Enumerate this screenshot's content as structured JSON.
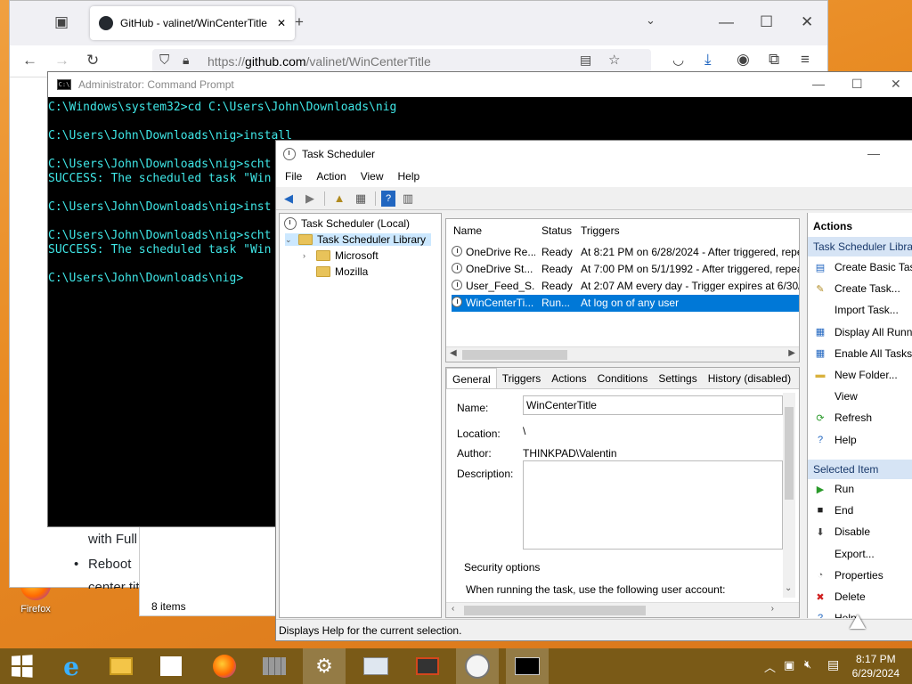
{
  "desktop": {
    "firefox_icon_label": "Firefox"
  },
  "firefox": {
    "tab_title": "GitHub - valinet/WinCenterTitle",
    "new_tab": "+",
    "url_scheme": "https://",
    "url_domain": "github.com",
    "url_path": "/valinet/WinCenterTitle",
    "page_text_1": "with Full",
    "page_bullet": "Reboot",
    "page_text_2": "center tit"
  },
  "cmd": {
    "title": "Administrator: Command Prompt",
    "lines": [
      "C:\\Windows\\system32>cd C:\\Users\\John\\Downloads\\nig",
      "",
      "C:\\Users\\John\\Downloads\\nig>install",
      "",
      "C:\\Users\\John\\Downloads\\nig>scht",
      "SUCCESS: The scheduled task \"Win",
      "",
      "C:\\Users\\John\\Downloads\\nig>inst",
      "",
      "C:\\Users\\John\\Downloads\\nig>scht",
      "SUCCESS: The scheduled task \"Win",
      "",
      "C:\\Users\\John\\Downloads\\nig>"
    ]
  },
  "explorer": {
    "item_count": "8 items"
  },
  "task_scheduler": {
    "title": "Task Scheduler",
    "menu": [
      "File",
      "Action",
      "View",
      "Help"
    ],
    "tree": {
      "root": "Task Scheduler (Local)",
      "library": "Task Scheduler Library",
      "children": [
        "Microsoft",
        "Mozilla"
      ]
    },
    "list": {
      "columns": [
        "Name",
        "Status",
        "Triggers"
      ],
      "rows": [
        {
          "name": "OneDrive Re...",
          "status": "Ready",
          "trigger": "At 8:21 PM on 6/28/2024 - After triggered, repe"
        },
        {
          "name": "OneDrive St...",
          "status": "Ready",
          "trigger": "At 7:00 PM on 5/1/1992 - After triggered, repea"
        },
        {
          "name": "User_Feed_S...",
          "status": "Ready",
          "trigger": "At 2:07 AM every day - Trigger expires at 6/30/2"
        },
        {
          "name": "WinCenterTi...",
          "status": "Run...",
          "trigger": "At log on of any user"
        }
      ]
    },
    "detail": {
      "tabs": [
        "General",
        "Triggers",
        "Actions",
        "Conditions",
        "Settings",
        "History (disabled)"
      ],
      "name_label": "Name:",
      "name_value": "WinCenterTitle",
      "location_label": "Location:",
      "location_value": "\\",
      "author_label": "Author:",
      "author_value": "THINKPAD\\Valentin",
      "description_label": "Description:",
      "security_label": "Security options",
      "security_text": "When running the task, use the following user account:"
    },
    "actions": {
      "header": "Actions",
      "section1": "Task Scheduler Library",
      "section1_items": [
        "Create Basic Task...",
        "Create Task...",
        "Import Task...",
        "Display All Running Tasks",
        "Enable All Tasks History",
        "New Folder...",
        "View",
        "Refresh",
        "Help"
      ],
      "section2": "Selected Item",
      "section2_items": [
        "Run",
        "End",
        "Disable",
        "Export...",
        "Properties",
        "Delete",
        "Help"
      ]
    },
    "status_bar": "Displays Help for the current selection."
  },
  "taskbar": {
    "time": "8:17 PM",
    "date": "6/29/2024"
  },
  "colors": {
    "cmd_text": "#3fe6e6",
    "selection": "#0078d7",
    "taskbar": "#7a5a17"
  }
}
